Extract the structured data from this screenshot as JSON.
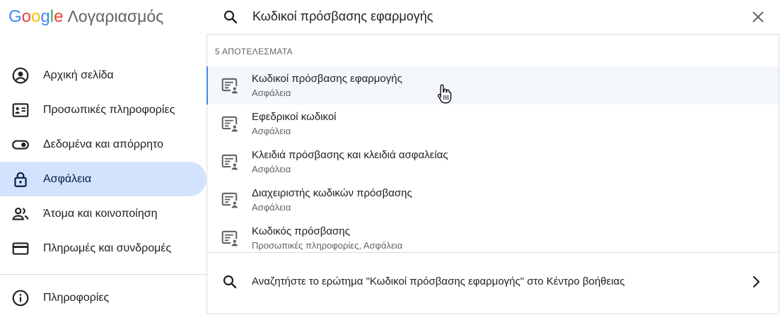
{
  "logo": {
    "letters": [
      {
        "char": "G",
        "color": "#4285F4"
      },
      {
        "char": "o",
        "color": "#EA4335"
      },
      {
        "char": "o",
        "color": "#FBBC05"
      },
      {
        "char": "g",
        "color": "#4285F4"
      },
      {
        "char": "l",
        "color": "#34A853"
      },
      {
        "char": "e",
        "color": "#EA4335"
      }
    ],
    "product": "Λογαριασμός"
  },
  "search": {
    "icon": "search-icon",
    "query": "Κωδικοί πρόσβασης εφαρμογής",
    "clear_icon": "close-icon"
  },
  "sidebar": {
    "items": [
      {
        "label": "Αρχική σελίδα",
        "icon": "account-circle-icon",
        "active": false
      },
      {
        "label": "Προσωπικές πληροφορίες",
        "icon": "id-card-icon",
        "active": false
      },
      {
        "label": "Δεδομένα και απόρρητο",
        "icon": "toggle-icon",
        "active": false
      },
      {
        "label": "Ασφάλεια",
        "icon": "lock-icon",
        "active": true
      },
      {
        "label": "Άτομα και κοινοποίηση",
        "icon": "people-icon",
        "active": false
      },
      {
        "label": "Πληρωμές και συνδρομές",
        "icon": "credit-card-icon",
        "active": false
      }
    ],
    "info": {
      "label": "Πληροφορίες",
      "icon": "info-icon"
    }
  },
  "results": {
    "heading": "5 ΑΠΟΤΕΛΕΣΜΑΤΑ",
    "items": [
      {
        "title": "Κωδικοί πρόσβασης εφαρμογής",
        "subtitle": "Ασφάλεια",
        "icon": "password-account-icon",
        "hovered": true
      },
      {
        "title": "Εφεδρικοί κωδικοί",
        "subtitle": "Ασφάλεια",
        "icon": "password-account-icon",
        "hovered": false
      },
      {
        "title": "Κλειδιά πρόσβασης και κλειδιά ασφαλείας",
        "subtitle": "Ασφάλεια",
        "icon": "password-account-icon",
        "hovered": false
      },
      {
        "title": "Διαχειριστής κωδικών πρόσβασης",
        "subtitle": "Ασφάλεια",
        "icon": "password-account-icon",
        "hovered": false
      },
      {
        "title": "Κωδικός πρόσβασης",
        "subtitle": "Προσωπικές πληροφορίες, Ασφάλεια",
        "icon": "password-account-icon",
        "hovered": false
      }
    ],
    "help": {
      "text": "Αναζητήστε το ερώτημα \"Κωδικοί πρόσβασης εφαρμογής\" στο Κέντρο βοήθειας",
      "icon": "search-icon",
      "chevron": "chevron-right-icon"
    }
  },
  "colors": {
    "active_nav_bg": "#d3e3fd",
    "hover_row_bg": "#f4f7fb",
    "hover_indicator": "#4285f4",
    "divider": "#dadce0",
    "secondary_text": "#5f6368"
  }
}
